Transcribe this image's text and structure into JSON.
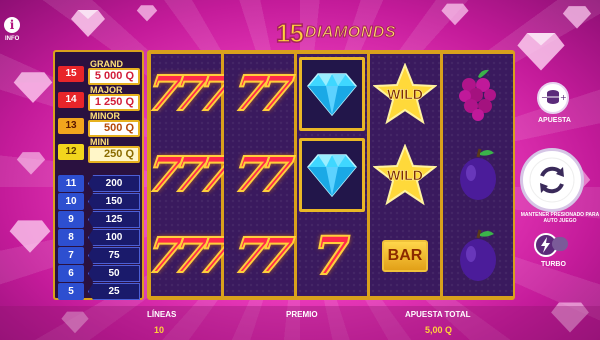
{
  "header": {
    "info_label": "INFO",
    "logo_number": "15",
    "logo_word": "DIAMONDS"
  },
  "paytable": {
    "jackpots": [
      {
        "lines": "15",
        "name": "GRAND",
        "value": "5 000 Q",
        "color": "#e8252a"
      },
      {
        "lines": "14",
        "name": "MAJOR",
        "value": "1 250 Q",
        "color": "#e8252a"
      },
      {
        "lines": "13",
        "name": "MINOR",
        "value": "500 Q",
        "color": "#f2a51d"
      },
      {
        "lines": "12",
        "name": "MINI",
        "value": "250 Q",
        "color": "#f2d51d"
      }
    ],
    "payouts": [
      {
        "lines": "11",
        "value": "200"
      },
      {
        "lines": "10",
        "value": "150"
      },
      {
        "lines": "9",
        "value": "125"
      },
      {
        "lines": "8",
        "value": "100"
      },
      {
        "lines": "7",
        "value": "75"
      },
      {
        "lines": "6",
        "value": "50"
      },
      {
        "lines": "5",
        "value": "25"
      }
    ]
  },
  "reels": [
    [
      "triple-seven",
      "triple-seven",
      "triple-seven"
    ],
    [
      "double-seven",
      "double-seven",
      "double-seven"
    ],
    [
      "diamond",
      "diamond",
      "single-seven"
    ],
    [
      "wild",
      "wild",
      "bar"
    ],
    [
      "grapes",
      "plum",
      "plum"
    ]
  ],
  "symbols": {
    "wild_label": "WILD",
    "bar_label": "BAR",
    "seven_char": "7"
  },
  "controls": {
    "bet_label": "APUESTA",
    "autoplay_label": "MANTENER PRESIONADO PARA AUTO JUEGO",
    "turbo_label": "TURBO"
  },
  "footer": {
    "lines_label": "LÍNEAS",
    "lines_value": "10",
    "prize_label": "PREMIO",
    "total_bet_label": "APUESTA TOTAL",
    "total_bet_value": "5,00 Q"
  },
  "colors": {
    "gold": "#d9a11c",
    "reel_bg": "#3a1a5e",
    "background": "#f03fc0"
  }
}
